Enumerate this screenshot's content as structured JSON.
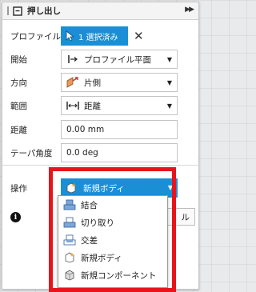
{
  "dialog": {
    "title": "押し出し",
    "expand_glyph": "▶▶",
    "profile": {
      "label": "プロファイル",
      "selection_text": "1 選択済み",
      "clear_glyph": "✕"
    },
    "start": {
      "label": "開始",
      "value": "プロファイル平面"
    },
    "direction": {
      "label": "方向",
      "value": "片側"
    },
    "extent": {
      "label": "範囲",
      "value": "距離"
    },
    "distance": {
      "label": "距離",
      "value": "0.00 mm"
    },
    "taper": {
      "label": "テーパ角度",
      "value": "0.0 deg"
    },
    "operation": {
      "label": "操作",
      "value": "新規ボディ"
    },
    "cancel_label": "ル",
    "info_glyph": "i"
  },
  "operation_menu": [
    {
      "label": "結合",
      "icon": "join-icon"
    },
    {
      "label": "切り取り",
      "icon": "cut-icon"
    },
    {
      "label": "交差",
      "icon": "intersect-icon"
    },
    {
      "label": "新規ボディ",
      "icon": "new-body-icon"
    },
    {
      "label": "新規コンポーネント",
      "icon": "new-component-icon"
    }
  ],
  "colors": {
    "accent": "#1b8fd6",
    "highlight": "#e8141c"
  }
}
